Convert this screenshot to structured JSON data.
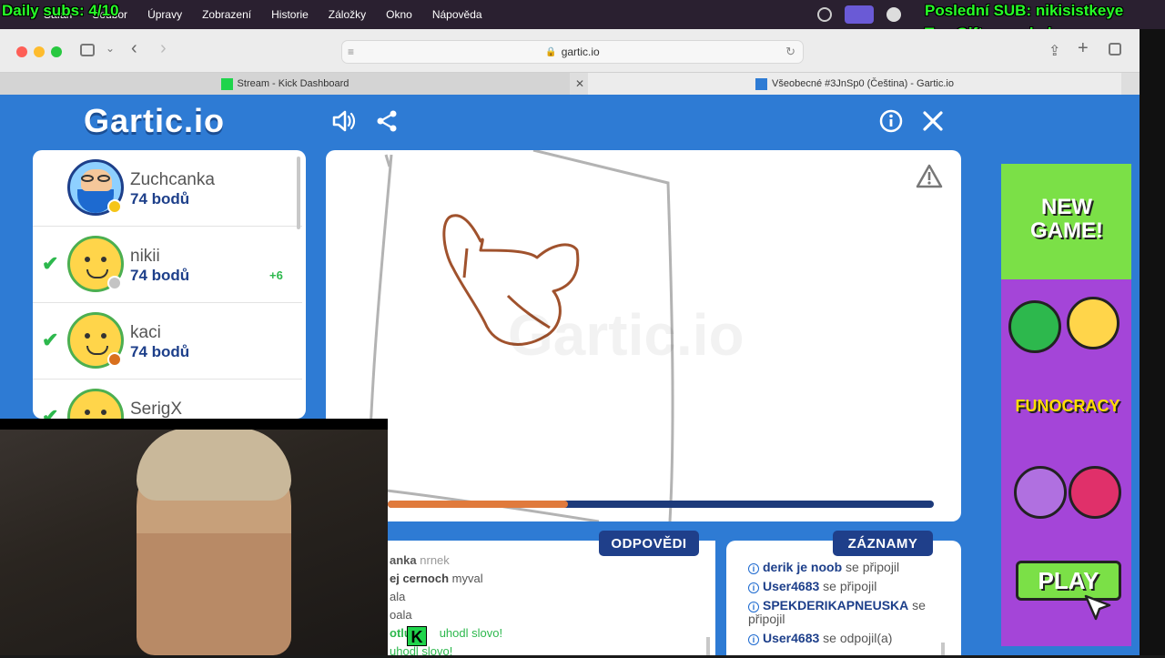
{
  "overlay": {
    "daily_subs": "Daily subs: 4/10",
    "last_sub": "Poslední SUB: nikisistkeye",
    "top_gifter": "Top Gifter: malydano"
  },
  "menubar": {
    "items": [
      "Safari",
      "Soubor",
      "Úpravy",
      "Zobrazení",
      "Historie",
      "Záložky",
      "Okno",
      "Nápověda"
    ]
  },
  "browser": {
    "url": "gartic.io",
    "tabs": [
      {
        "label": "Stream - Kick Dashboard"
      },
      {
        "label": "Všeobecné #3JnSp0 (Čeština) - Gartic.io"
      }
    ]
  },
  "game": {
    "logo": "Gartic.io",
    "players": [
      {
        "name": "Zuchcanka",
        "points": "74 bodů",
        "guessed": false,
        "bonus": "",
        "badge_color": "#f5c518"
      },
      {
        "name": "nikii",
        "points": "74 bodů",
        "guessed": true,
        "bonus": "+6",
        "badge_color": "#c4c4c4"
      },
      {
        "name": "kaci",
        "points": "74 bodů",
        "guessed": true,
        "bonus": "",
        "badge_color": "#d9701e"
      },
      {
        "name": "SerigX",
        "points": "",
        "guessed": true,
        "bonus": "",
        "badge_color": ""
      }
    ],
    "timer_progress": 0.33,
    "answers_label": "ODPOVĚDI",
    "records_label": "ZÁZNAMY",
    "answers": [
      {
        "user": "anka",
        "text": "nrnek"
      },
      {
        "user": "ej cernoch",
        "text": "myval"
      },
      {
        "user": "",
        "text": "ala"
      },
      {
        "user": "",
        "text": "oala"
      },
      {
        "user": "otluk",
        "text": "uhodl slovo!"
      },
      {
        "user": "",
        "text": "uhodl slovo!"
      }
    ],
    "records": [
      {
        "user": "derik je noob",
        "text": "se připojil"
      },
      {
        "user": "User4683",
        "text": "se připojil"
      },
      {
        "user": "SPEKDERIKAPNEUSKA",
        "text": "se připojil"
      },
      {
        "user": "User4683",
        "text": "se odpojil(a)"
      }
    ]
  },
  "ad": {
    "headline": "NEW GAME!",
    "brand": "FUNOCRACY",
    "cta": "PLAY"
  },
  "colors": {
    "page_bg": "#2e7bd4",
    "navy": "#1d3f8a",
    "green_check": "#2db84d",
    "overlay_green": "#27ff27"
  }
}
